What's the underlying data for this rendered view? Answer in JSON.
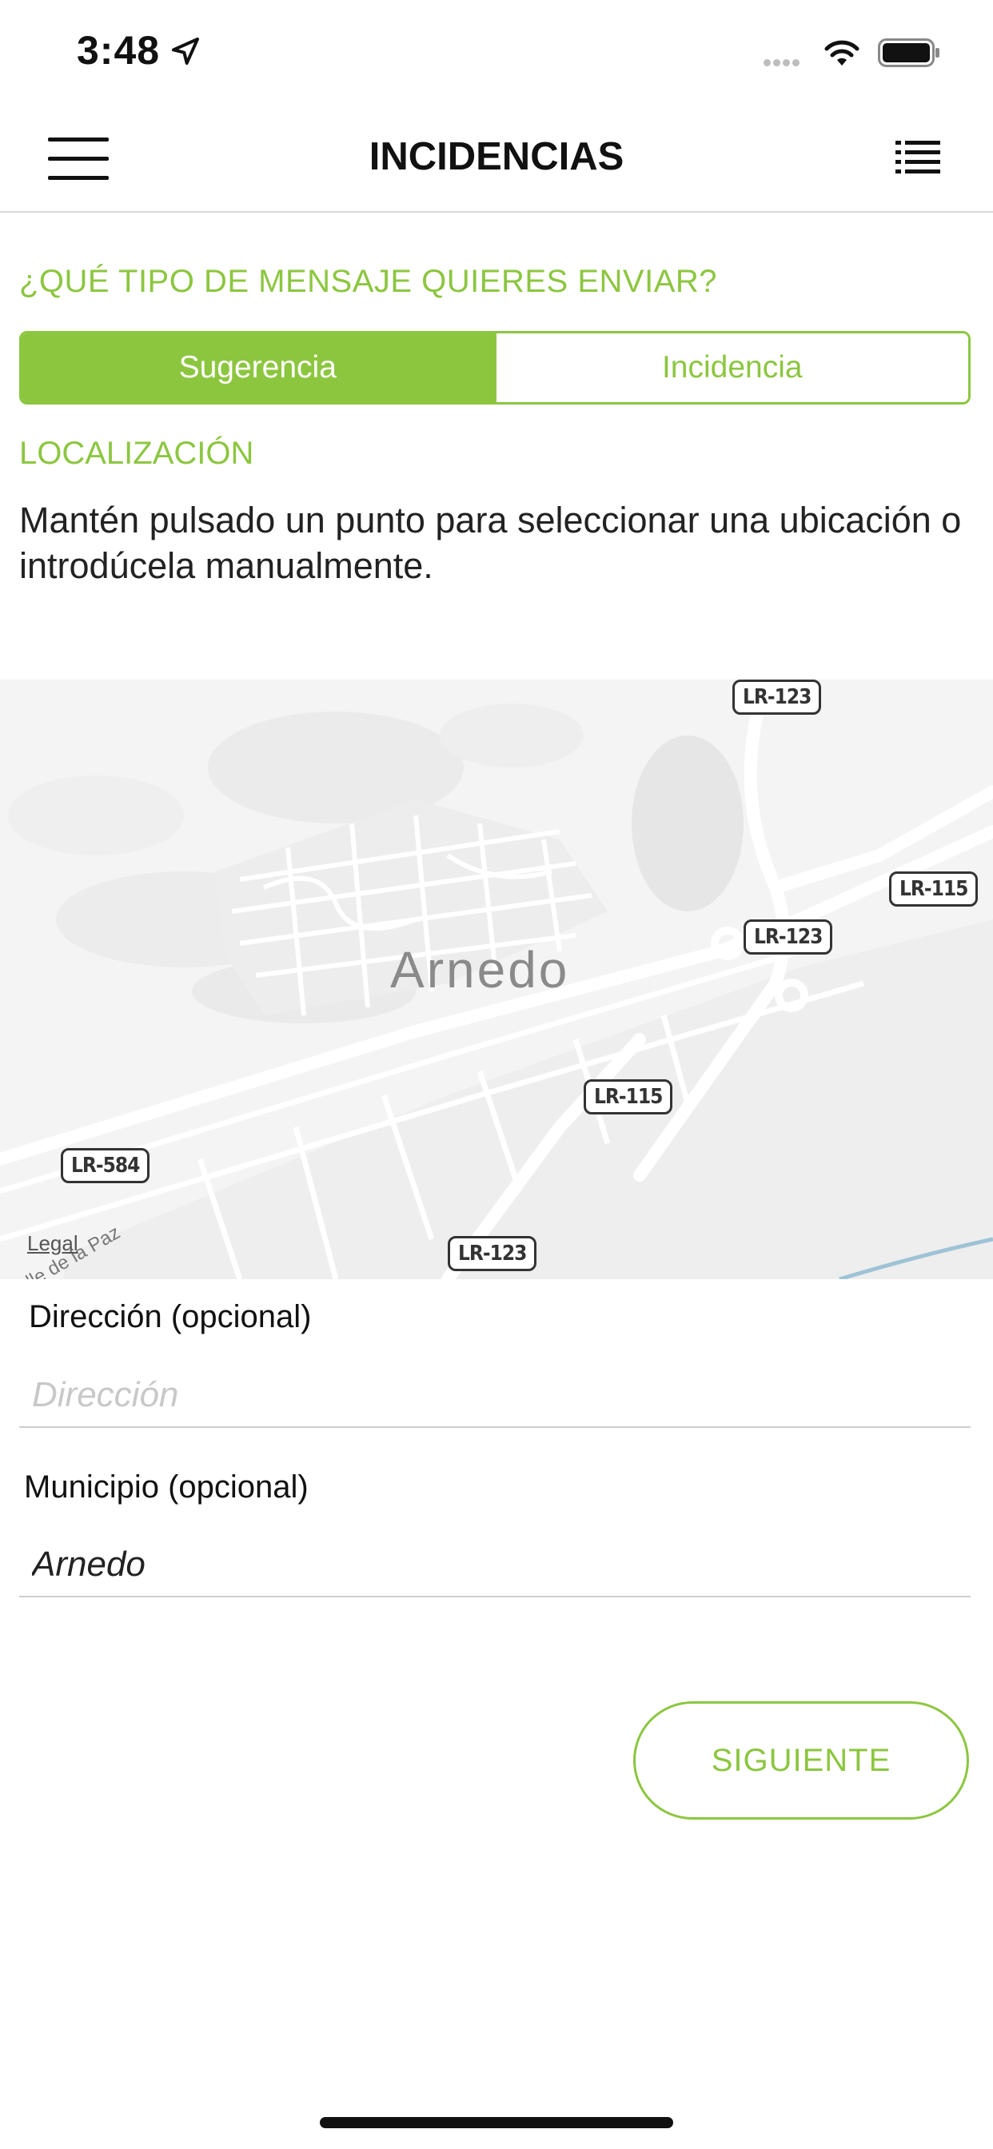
{
  "status_bar": {
    "time": "3:48"
  },
  "nav": {
    "title": "INCIDENCIAS"
  },
  "form": {
    "question": "¿QUÉ TIPO DE MENSAJE QUIERES ENVIAR?",
    "segments": [
      {
        "label": "Sugerencia",
        "selected": true
      },
      {
        "label": "Incidencia",
        "selected": false
      }
    ],
    "location_heading": "LOCALIZACIÓN",
    "instructions": "Mantén pulsado un punto para seleccionar una ubicación o introdúcela manualmente."
  },
  "map": {
    "city": "Arnedo",
    "legal": "Legal",
    "road_signs": [
      "LR-123",
      "LR-115",
      "LR-123",
      "LR-115",
      "LR-584",
      "LR-123"
    ]
  },
  "address": {
    "label": "Dirección (opcional)",
    "value": "",
    "placeholder": "Dirección"
  },
  "municipality": {
    "label": "Municipio (opcional)",
    "value": "Arnedo",
    "placeholder": ""
  },
  "actions": {
    "next_label": "SIGUIENTE"
  },
  "colors": {
    "accent": "#8cc63f",
    "text": "#111111",
    "divider": "#d9d9d9"
  },
  "icons": {
    "menu": "hamburger-icon",
    "list": "list-icon",
    "location": "location-arrow-icon"
  }
}
